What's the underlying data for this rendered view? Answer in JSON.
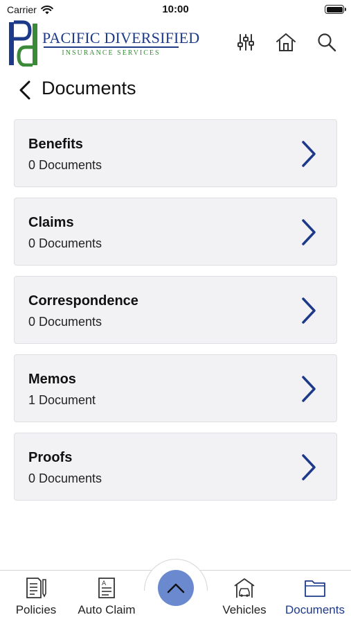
{
  "status_bar": {
    "carrier": "Carrier",
    "time": "10:00"
  },
  "header": {
    "brand_name": "PACIFIC DIVERSIFIED",
    "brand_subtitle": "INSURANCE SERVICES",
    "icons": [
      "filter-sliders-icon",
      "home-icon",
      "search-icon"
    ]
  },
  "page": {
    "title": "Documents",
    "back_icon": "chevron-left-icon"
  },
  "folders": [
    {
      "title": "Benefits",
      "count": "0 Documents"
    },
    {
      "title": "Claims",
      "count": "0 Documents"
    },
    {
      "title": "Correspondence",
      "count": "0 Documents"
    },
    {
      "title": "Memos",
      "count": "1 Document"
    },
    {
      "title": "Proofs",
      "count": "0 Documents"
    }
  ],
  "tab_bar": {
    "tabs": [
      {
        "label": "Policies",
        "icon": "policy-document-icon",
        "active": false
      },
      {
        "label": "Auto Claim",
        "icon": "claim-form-icon",
        "active": false
      },
      {
        "label": "Vehicles",
        "icon": "garage-car-icon",
        "active": false
      },
      {
        "label": "Documents",
        "icon": "folder-icon",
        "active": true
      }
    ],
    "center_button_icon": "chevron-up-icon"
  },
  "colors": {
    "brand_blue": "#1d3a8a",
    "brand_green": "#3a8a3a",
    "chevron_blue": "#1d3a8a",
    "fab_blue": "#6a89cf",
    "card_bg": "#f2f2f5"
  }
}
